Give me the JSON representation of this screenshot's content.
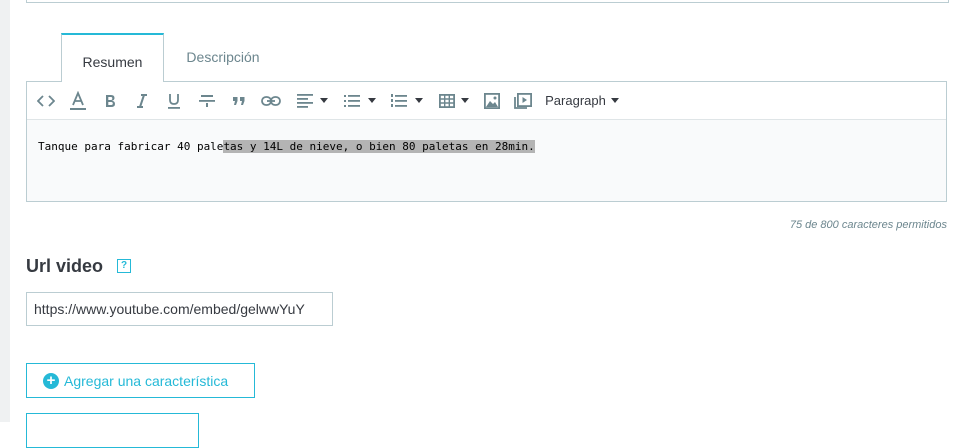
{
  "tabs": [
    {
      "label": "Resumen",
      "active": true
    },
    {
      "label": "Descripción",
      "active": false
    }
  ],
  "toolbar": {
    "items": [
      "code-view-icon",
      "text-color-icon",
      "bold-icon",
      "italic-icon",
      "underline-icon",
      "strikethrough-icon",
      "blockquote-icon",
      "link-icon",
      "align-icon",
      "bullet-list-icon",
      "numbered-list-icon",
      "table-icon",
      "image-icon",
      "media-icon"
    ],
    "format_select": "Paragraph"
  },
  "editor": {
    "text_plain": "Tanque para fabricar 40 pale",
    "text_selected": "tas y 14L de nieve, o bien 80 paletas en 28min."
  },
  "counter": "75 de 800 caracteres permitidos",
  "url_video": {
    "label": "Url video",
    "help_glyph": "?",
    "value": "https://www.youtube.com/embed/gelwwYuY"
  },
  "buttons": {
    "add_feature": "Agregar una característica"
  },
  "colors": {
    "accent": "#25b9d7",
    "border": "#bbcdd2",
    "text": "#363a41",
    "muted": "#6c868e"
  }
}
